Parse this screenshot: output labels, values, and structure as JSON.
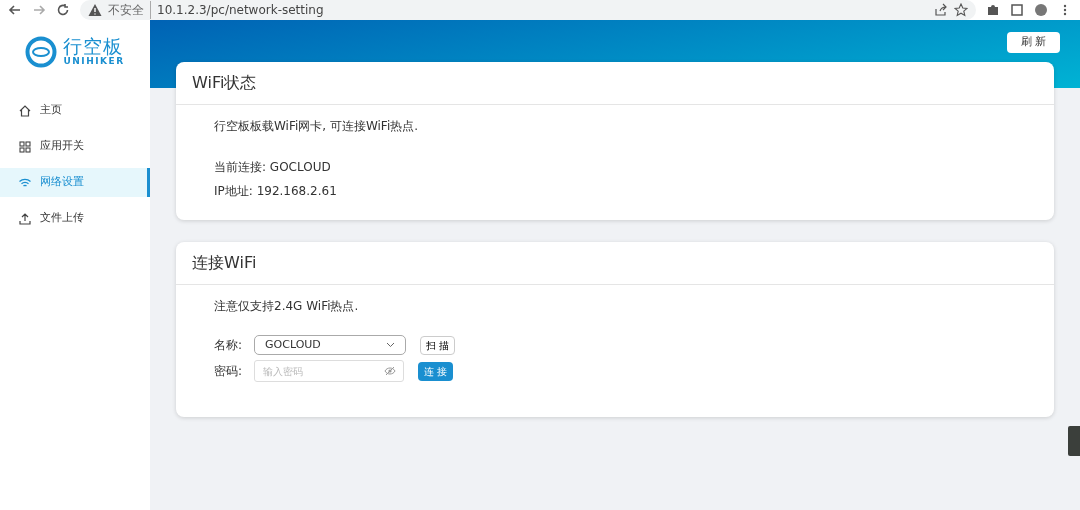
{
  "browser": {
    "security_label": "不安全",
    "url": "10.1.2.3/pc/network-setting"
  },
  "logo": {
    "name": "行空板",
    "subtitle": "UNIHIKER"
  },
  "sidebar": {
    "items": [
      {
        "label": "主页",
        "selected": false
      },
      {
        "label": "应用开关",
        "selected": false
      },
      {
        "label": "网络设置",
        "selected": true
      },
      {
        "label": "文件上传",
        "selected": false
      }
    ]
  },
  "refresh_button": "刷 新",
  "wifi_status": {
    "title": "WiFi状态",
    "description": "行空板板载WiFi网卡, 可连接WiFi热点.",
    "lines": [
      "当前连接: GOCLOUD",
      "IP地址: 192.168.2.61"
    ]
  },
  "connect_wifi": {
    "title": "连接WiFi",
    "note": "注意仅支持2.4G WiFi热点.",
    "name_label": "名称:",
    "network": "GOCLOUD",
    "scan_button": "扫 描",
    "password_label": "密码:",
    "password_placeholder": "输入密码",
    "connect_button": "连 接"
  }
}
